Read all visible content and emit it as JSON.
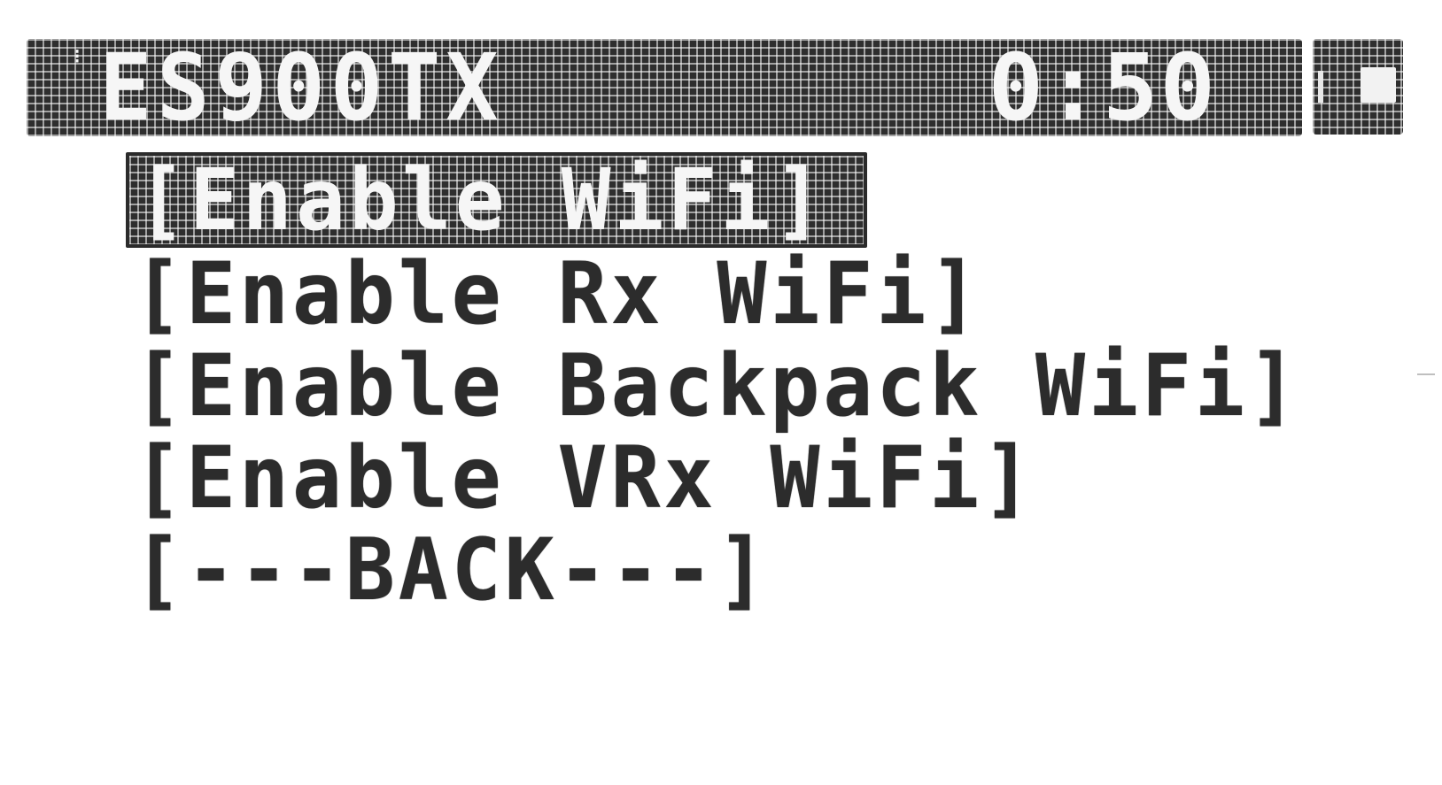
{
  "header": {
    "cursor_glyph": "⁝",
    "title": "ES900TX",
    "time": "0:50"
  },
  "battery": {
    "icon": "battery-icon",
    "level": 0.4
  },
  "menu": {
    "selected_index": 0,
    "items": [
      {
        "label": "[Enable WiFi]"
      },
      {
        "label": "[Enable Rx WiFi]"
      },
      {
        "label": "[Enable Backpack WiFi]"
      },
      {
        "label": "[Enable VRx WiFi]"
      },
      {
        "label": "[---BACK---]"
      }
    ]
  },
  "colors": {
    "display_bg": "#ffffff",
    "pixel_on": "#2e2e2e",
    "pixel_off": "#f6f6f6"
  }
}
